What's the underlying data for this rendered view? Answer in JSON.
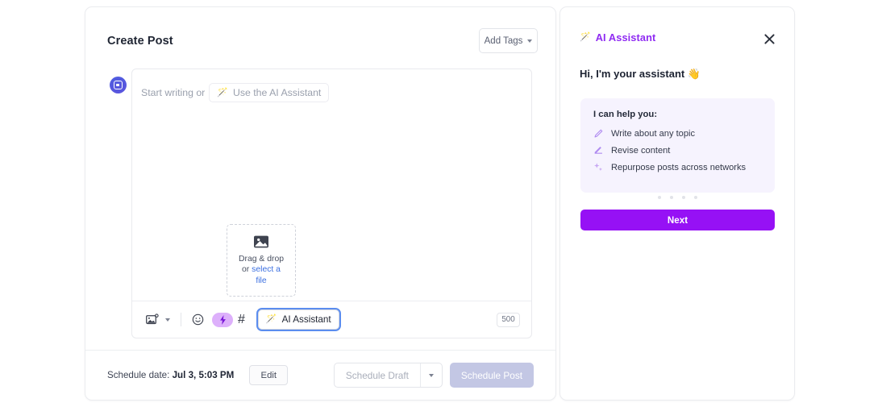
{
  "compose": {
    "title": "Create Post",
    "add_tags_label": "Add Tags",
    "editor": {
      "placeholder_prefix": "Start writing or",
      "ai_pill_label": "Use the AI Assistant",
      "ai_pill_icon": "magic-wand-icon",
      "avatar_icon": "profile-avatar-icon"
    },
    "dropzone": {
      "icon": "image-placeholder-icon",
      "line1": "Drag & drop",
      "line2_prefix": "or ",
      "link_label": "select a file"
    },
    "toolbar": {
      "image_icon": "image-upload-icon",
      "image_caret_icon": "chevron-down-icon",
      "emoji_icon": "emoji-smiley-icon",
      "bolt_icon": "lightning-bolt-icon",
      "hashtag_icon": "hashtag-icon",
      "ai_assistant_label": "AI Assistant",
      "ai_assistant_icon": "magic-wand-icon",
      "char_count": "500"
    },
    "footer": {
      "schedule_prefix": "Schedule date:",
      "schedule_value": "Jul 3, 5:03 PM",
      "edit_label": "Edit",
      "draft_label": "Schedule Draft",
      "draft_caret_icon": "chevron-down-icon",
      "post_label": "Schedule Post"
    }
  },
  "assistant": {
    "title": "AI Assistant",
    "title_icon": "magic-wand-icon",
    "close_icon": "close-icon",
    "greeting": "Hi, I'm your assistant 👋",
    "help_card": {
      "heading": "I can help you:",
      "items": [
        {
          "icon": "pencil-icon",
          "label": "Write about any topic"
        },
        {
          "icon": "revise-edit-icon",
          "label": "Revise content"
        },
        {
          "icon": "sparkles-icon",
          "label": "Repurpose posts across networks"
        }
      ]
    },
    "pagination": {
      "count": 4,
      "active_index": 0
    },
    "next_label": "Next"
  },
  "colors": {
    "accent_purple": "#9611f5",
    "assistant_title": "#8f2bf2",
    "help_card_bg": "#f6f3fe",
    "disabled_post": "#c3c7e4",
    "link_blue": "#3b6fe0",
    "focus_ring": "#5b8def"
  }
}
